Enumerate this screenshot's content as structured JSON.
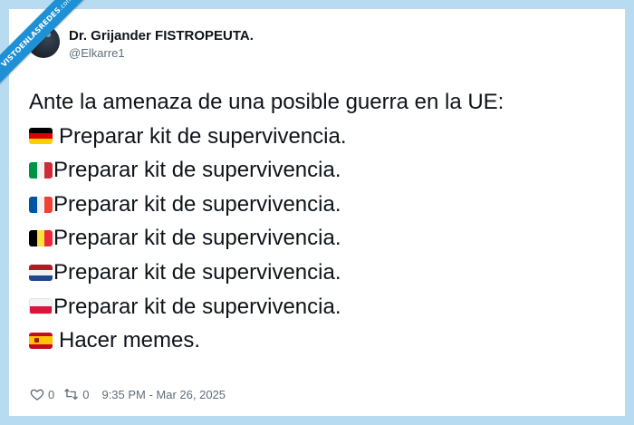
{
  "watermark": {
    "text": "VISTOENLASREDES",
    "suffix": ".com"
  },
  "author": {
    "display_name": "Dr. Grijander FISTROPEUTA.",
    "handle": "@Elkarre1"
  },
  "tweet": {
    "intro": "Ante la amenaza de una posible guerra en la UE:",
    "items": [
      {
        "flag": "germany-flag-icon",
        "text": "Preparar kit de supervivencia."
      },
      {
        "flag": "italy-flag-icon",
        "text": "Preparar kit de supervivencia."
      },
      {
        "flag": "france-flag-icon",
        "text": "Preparar kit de supervivencia."
      },
      {
        "flag": "belgium-flag-icon",
        "text": "Preparar kit de supervivencia."
      },
      {
        "flag": "netherlands-flag-icon",
        "text": "Preparar kit de supervivencia."
      },
      {
        "flag": "poland-flag-icon",
        "text": "Preparar kit de supervivencia."
      },
      {
        "flag": "spain-flag-icon",
        "text": "Hacer memes."
      }
    ]
  },
  "footer": {
    "likes": "0",
    "retweets": "0",
    "timestamp": "9:35 PM - Mar 26, 2025"
  },
  "colors": {
    "frame_border": "#b7dcf2",
    "ribbon": "#1e90d6",
    "text": "#0f1419",
    "muted": "#606d78"
  }
}
